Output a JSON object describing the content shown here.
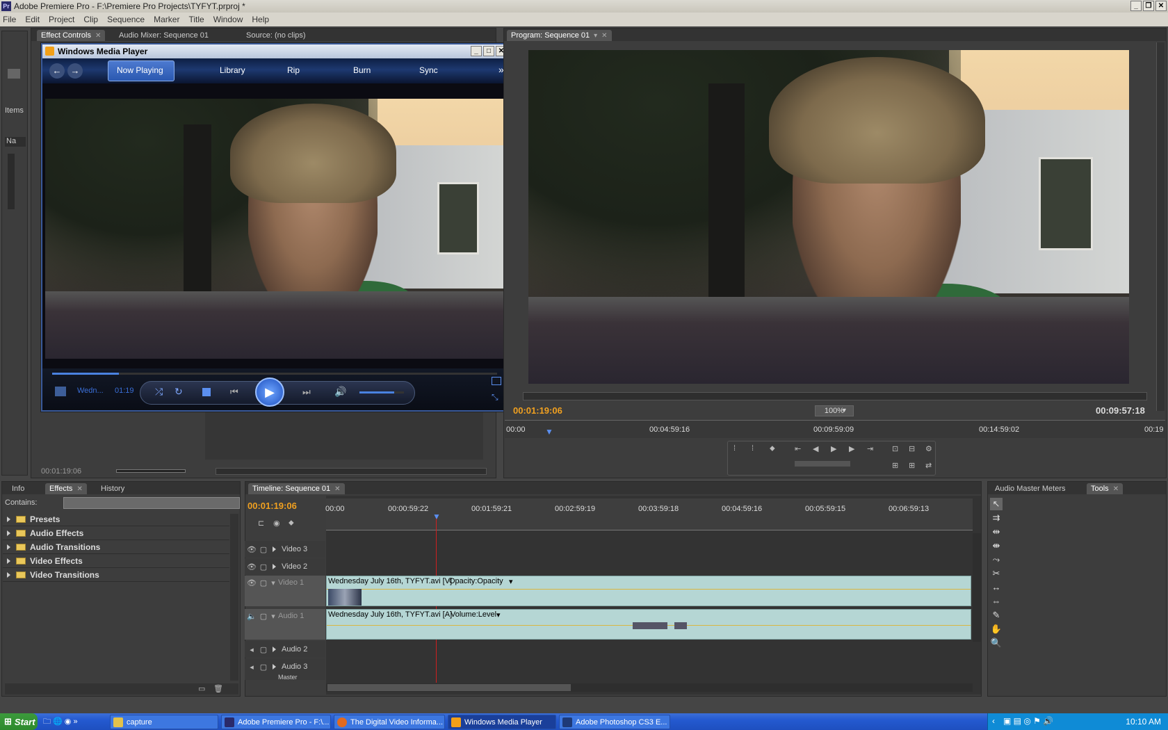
{
  "window": {
    "title": "Adobe Premiere Pro - F:\\Premiere Pro Projects\\TYFYT.prproj *",
    "app_badge": "Pr"
  },
  "menu": [
    "File",
    "Edit",
    "Project",
    "Clip",
    "Sequence",
    "Marker",
    "Title",
    "Window",
    "Help"
  ],
  "source_panel": {
    "tabs": [
      "Effect Controls",
      "Audio Mixer: Sequence 01",
      "Source: (no clips)"
    ],
    "timecode": "00:01:19:06"
  },
  "project_panel": {
    "items_label": "Items",
    "name_label": "Na"
  },
  "wmp": {
    "title": "Windows Media Player",
    "tabs": [
      "Now Playing",
      "Library",
      "Rip",
      "Burn",
      "Sync"
    ],
    "more": "»",
    "now_playing_title": "Wedn...",
    "now_playing_time": "01:19",
    "progress": 0.15,
    "volume": 0.78
  },
  "program": {
    "tab": "Program: Sequence 01",
    "timecode": "00:01:19:06",
    "duration": "00:09:57:18",
    "zoom": "100%",
    "ruler": [
      "00:00",
      "00:04:59:16",
      "00:09:59:09",
      "00:14:59:02",
      "00:19"
    ]
  },
  "effects_panel": {
    "tabs": [
      "Info",
      "Effects",
      "History"
    ],
    "contains_label": "Contains:",
    "folders": [
      "Presets",
      "Audio Effects",
      "Audio Transitions",
      "Video Effects",
      "Video Transitions"
    ]
  },
  "timeline": {
    "tab": "Timeline: Sequence 01",
    "timecode": "00:01:19:06",
    "ruler": [
      "00:00",
      "00:00:59:22",
      "00:01:59:21",
      "00:02:59:19",
      "00:03:59:18",
      "00:04:59:16",
      "00:05:59:15",
      "00:06:59:13"
    ],
    "tracks": [
      "Video 3",
      "Video 2",
      "Video 1",
      "Audio 1",
      "Audio 2",
      "Audio 3",
      "Master"
    ],
    "video_clip": {
      "name": "Wednesday July 16th, TYFYT.avi [V]",
      "fx": "Opacity:Opacity"
    },
    "audio_clip": {
      "name": "Wednesday July 16th, TYFYT.avi [A]",
      "fx": "Volume:Level"
    }
  },
  "right_panel": {
    "tabs": [
      "Audio Master Meters",
      "Tools"
    ]
  },
  "taskbar": {
    "start": "Start",
    "items": [
      "capture",
      "Adobe Premiere Pro - F:\\...",
      "The Digital Video Informa...",
      "Windows Media Player",
      "Adobe Photoshop CS3 E..."
    ],
    "clock": "10:10 AM"
  },
  "colors": {
    "accent_timecode": "#f0a020",
    "clip": "#b5d6d4",
    "taskbar": "#245ad0"
  }
}
